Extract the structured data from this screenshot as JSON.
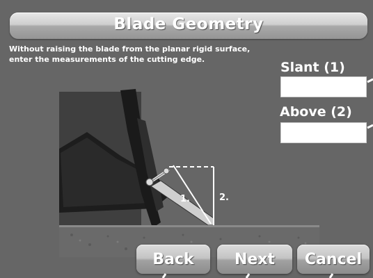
{
  "header": {
    "title": "Blade Geometry"
  },
  "instructions": "Without raising the blade from the planar rigid surface, enter the measurements of the cutting edge.",
  "fields": {
    "slant": {
      "label": "Slant (1)",
      "value": ""
    },
    "above": {
      "label": "Above (2)",
      "value": ""
    }
  },
  "diagram": {
    "marker_1": "1.",
    "marker_2": "2."
  },
  "buttons": {
    "back": "Back",
    "next": "Next",
    "cancel": "Cancel"
  },
  "colors": {
    "background": "#666666",
    "button_gradient_top": "#dcdcdc",
    "button_gradient_bottom": "#8c8c8c",
    "text": "#ffffff"
  }
}
